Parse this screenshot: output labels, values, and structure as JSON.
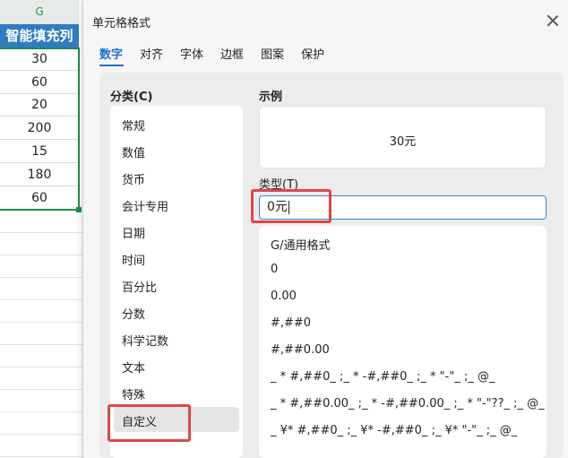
{
  "sheet": {
    "column_letter": "G",
    "header": "智能填充列",
    "values": [
      "30",
      "60",
      "20",
      "200",
      "15",
      "180",
      "60"
    ]
  },
  "dialog": {
    "title": "单元格格式",
    "tabs": [
      "数字",
      "对齐",
      "字体",
      "边框",
      "图案",
      "保护"
    ],
    "active_tab": "数字",
    "category_label": "分类(C)",
    "categories": [
      "常规",
      "数值",
      "货币",
      "会计专用",
      "日期",
      "时间",
      "百分比",
      "分数",
      "科学记数",
      "文本",
      "特殊",
      "自定义"
    ],
    "selected_category": "自定义",
    "sample_label": "示例",
    "sample_value": "30元",
    "type_label": "类型(T)",
    "type_value": "0元",
    "format_list": [
      "G/通用格式",
      "0",
      "0.00",
      "#,##0",
      "#,##0.00",
      "_ * #,##0_ ;_ * -#,##0_ ;_ * \"-\"_ ;_ @_",
      "_ * #,##0.00_ ;_ * -#,##0.00_ ;_ * \"-\"??_ ;_ @_",
      "_ ¥* #,##0_ ;_ ¥* -#,##0_ ;_ ¥* \"-\"_ ;_ @_"
    ]
  },
  "colors": {
    "accent": "#1f6fd0",
    "header_fill": "#2f7cc1",
    "highlight": "#e04646",
    "selection": "#1f8a4c"
  }
}
